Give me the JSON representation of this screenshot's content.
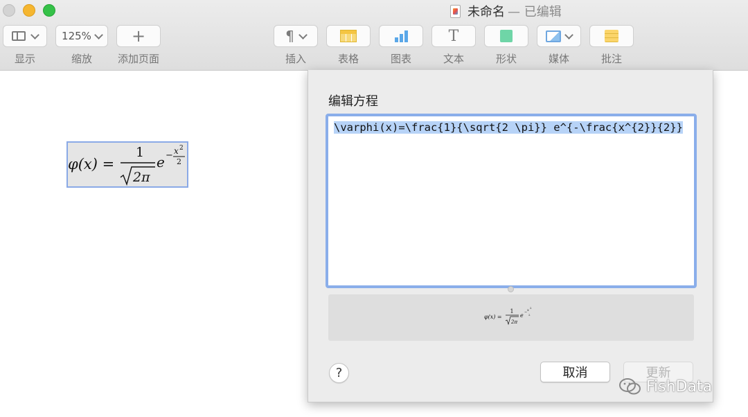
{
  "window": {
    "title": "未命名",
    "status": "— 已编辑"
  },
  "toolbar": {
    "view_label": "显示",
    "zoom_value": "125%",
    "zoom_label": "缩放",
    "add_page_label": "添加页面",
    "insert_label": "插入",
    "table_label": "表格",
    "chart_label": "图表",
    "text_label": "文本",
    "shape_label": "形状",
    "media_label": "媒体",
    "comment_label": "批注"
  },
  "dialog": {
    "title": "编辑方程",
    "latex": "\\varphi(x)=\\frac{1}{\\sqrt{2 \\pi}} e^{-\\frac{x^{2}}{2}}",
    "help_label": "?",
    "cancel_label": "取消",
    "update_label": "更新"
  },
  "equation": {
    "lhs": "φ(x) =",
    "numerator": "1",
    "denominator": "2π",
    "base": "e",
    "exp_sign": "−",
    "exp_num": "x",
    "exp_pow": "2",
    "exp_den": "2"
  },
  "watermark": {
    "text": "FishData"
  },
  "colors": {
    "selection": "#b7d3f7",
    "focus_ring": "#8aaeea",
    "close": "#d3d3d3",
    "minimize": "#f5b630",
    "zoom": "#35c148"
  }
}
